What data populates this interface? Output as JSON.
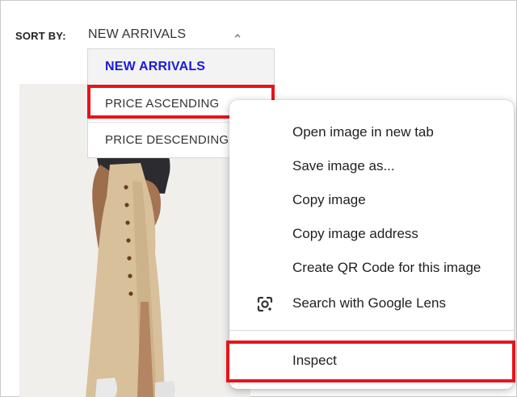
{
  "sort": {
    "label": "SORT BY:",
    "current_value": "NEW ARRIVALS",
    "caret_icon": "chevron-up-icon",
    "options": [
      "NEW ARRIVALS",
      "PRICE ASCENDING",
      "PRICE DESCENDING"
    ],
    "selected_index": 0
  },
  "context_menu": {
    "items": [
      "Open image in new tab",
      "Save image as...",
      "Copy image",
      "Copy image address",
      "Create QR Code for this image",
      "Search with Google Lens",
      "Inspect"
    ],
    "lens_icon": "google-lens-icon"
  },
  "colors": {
    "highlight_border": "#e8141b",
    "selected_option": "#1a1adb",
    "dress": "#d8c09b",
    "photo_background": "#f1efec"
  }
}
